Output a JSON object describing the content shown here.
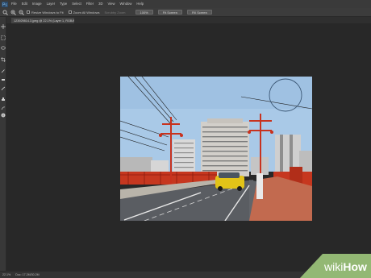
{
  "menu": {
    "items": [
      "File",
      "Edit",
      "Image",
      "Layer",
      "Type",
      "Select",
      "Filter",
      "3D",
      "View",
      "Window",
      "Help"
    ]
  },
  "options": {
    "resize_windows_label": "Resize Windows to Fit",
    "zoom_all_label": "Zoom All Windows",
    "scrubby_label": "Scrubby Zoom",
    "btn_100": "100%",
    "btn_fit": "Fit Screen",
    "btn_fill": "Fill Screen"
  },
  "document": {
    "tab_title": "123929814.3.jpeg @ 22.1% (Layer 1, RGB/8) *"
  },
  "status": {
    "zoom": "22.1%",
    "doc_size": "Doc: 17.2M/30.2M"
  },
  "watermark": {
    "text": "wikiHow"
  },
  "colors": {
    "accent_green": "#93b874",
    "pole_red": "#c8321e",
    "sky": "#a8c8e6"
  }
}
